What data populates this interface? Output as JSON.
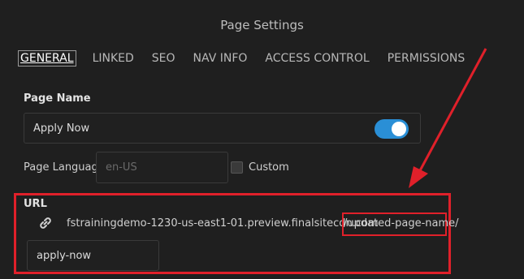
{
  "header": {
    "title": "Page Settings"
  },
  "tabs": [
    {
      "label": "GENERAL"
    },
    {
      "label": "LINKED"
    },
    {
      "label": "SEO"
    },
    {
      "label": "NAV INFO"
    },
    {
      "label": "ACCESS CONTROL"
    },
    {
      "label": "PERMISSIONS"
    }
  ],
  "page_name": {
    "label": "Page Name",
    "value": "Apply Now",
    "toggle_on": true
  },
  "page_language": {
    "label": "Page Language",
    "placeholder": "en-US",
    "custom_label": "Custom",
    "custom_checked": false
  },
  "url": {
    "label": "URL",
    "base": "fstrainingdemo-1230-us-east1-01.preview.finalsitecdn.com",
    "slug_display": "/updated-page-name/",
    "slug_value": "apply-now"
  },
  "colors": {
    "annotation": "#e0202a",
    "toggle": "#2a8fd6"
  },
  "icons": {
    "link": "link-icon"
  }
}
